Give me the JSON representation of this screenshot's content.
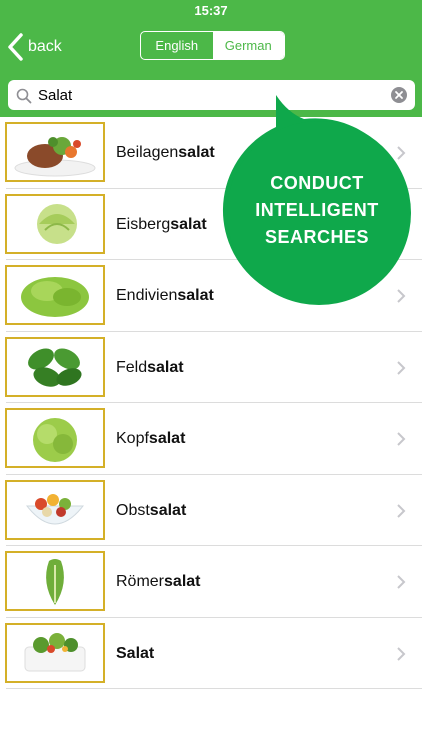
{
  "status": {
    "time": "15:37"
  },
  "nav": {
    "back_label": "back"
  },
  "segmented": {
    "english": "English",
    "german": "German",
    "selected": "German"
  },
  "search": {
    "value": "Salat"
  },
  "promo": {
    "line1": "CONDUCT",
    "line2": "INTELLIGENT",
    "line3": "SEARCHES"
  },
  "colors": {
    "accent": "#4cb848",
    "thumb_border": "#d4b028",
    "promo_bg": "#0fa84b"
  },
  "items": [
    {
      "prefix": "Beilagen",
      "match": "salat",
      "icon": "salad-side-dish-photo"
    },
    {
      "prefix": "Eisberg",
      "match": "salat",
      "icon": "iceberg-lettuce-photo"
    },
    {
      "prefix": "Endivien",
      "match": "salat",
      "icon": "endive-lettuce-photo"
    },
    {
      "prefix": "Feld",
      "match": "salat",
      "icon": "lambs-lettuce-photo"
    },
    {
      "prefix": "Kopf",
      "match": "salat",
      "icon": "head-lettuce-photo"
    },
    {
      "prefix": "Obst",
      "match": "salat",
      "icon": "fruit-salad-photo"
    },
    {
      "prefix": "Römer",
      "match": "salat",
      "icon": "romaine-lettuce-photo"
    },
    {
      "prefix": "",
      "match": "Salat",
      "icon": "mixed-salad-photo"
    }
  ]
}
